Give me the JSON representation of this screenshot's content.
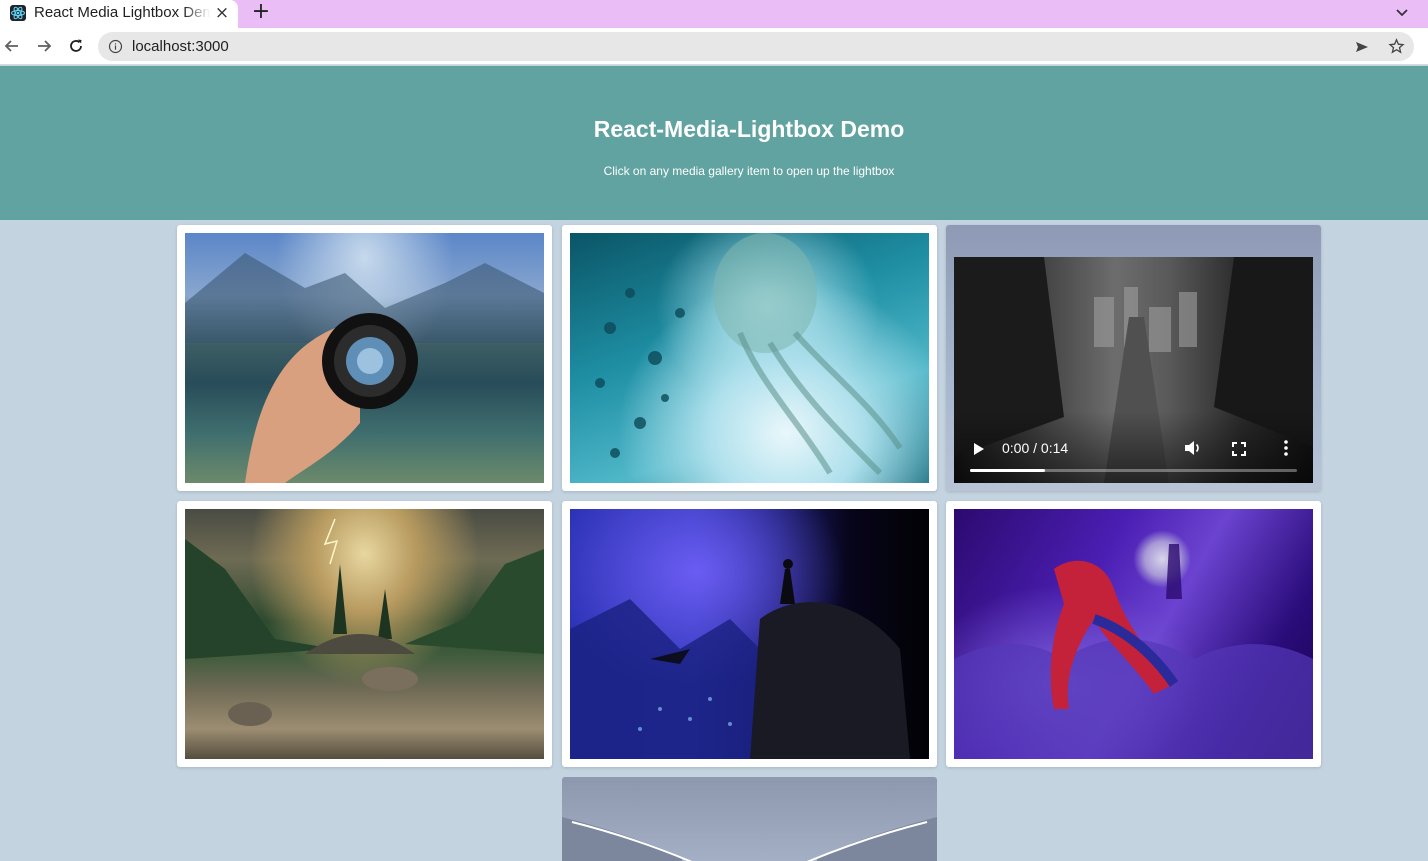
{
  "browser": {
    "tab_title": "React Media Lightbox Demo",
    "url": "localhost:3000",
    "new_tab_label": "+"
  },
  "hero": {
    "title": "React-Media-Lightbox Demo",
    "subtitle": "Click on any media gallery item to open up the lightbox",
    "background": "#61a3a1"
  },
  "gallery": {
    "background": "#c3d3df",
    "items": [
      {
        "kind": "image",
        "icon": "camera-lens-photo"
      },
      {
        "kind": "image",
        "icon": "jellyfish-photo"
      },
      {
        "kind": "video",
        "time": "0:00 / 0:14",
        "progress": 0.23
      },
      {
        "kind": "image",
        "icon": "mountain-lake-photo"
      },
      {
        "kind": "image",
        "icon": "black-panther-photo"
      },
      {
        "kind": "image",
        "icon": "spider-man-photo"
      },
      {
        "kind": "video",
        "icon": "corridor-video"
      }
    ]
  }
}
